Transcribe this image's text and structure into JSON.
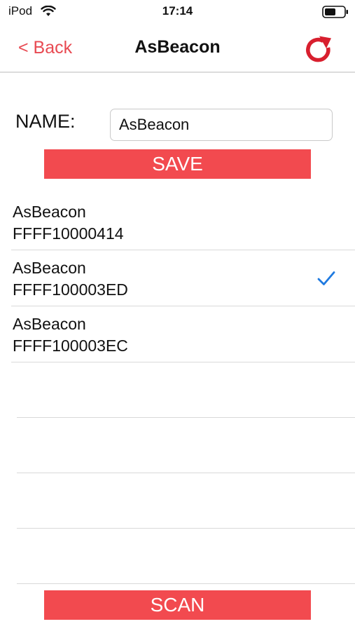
{
  "status_bar": {
    "carrier": "iPod",
    "time": "17:14",
    "wifi_icon": "wifi-icon",
    "battery_icon": "battery-icon"
  },
  "nav": {
    "back_label": "< Back",
    "title": "AsBeacon",
    "refresh_icon": "refresh-icon"
  },
  "form": {
    "name_label": "NAME:",
    "name_value": "AsBeacon",
    "save_label": "SAVE"
  },
  "devices": [
    {
      "name": "AsBeacon",
      "id": "FFFF10000414",
      "selected": false
    },
    {
      "name": "AsBeacon",
      "id": "FFFF100003ED",
      "selected": true
    },
    {
      "name": "AsBeacon",
      "id": "FFFF100003EC",
      "selected": false
    }
  ],
  "scan_label": "SCAN",
  "colors": {
    "accent": "#f24a4f",
    "link": "#e84a52",
    "check": "#1f7ae0"
  }
}
